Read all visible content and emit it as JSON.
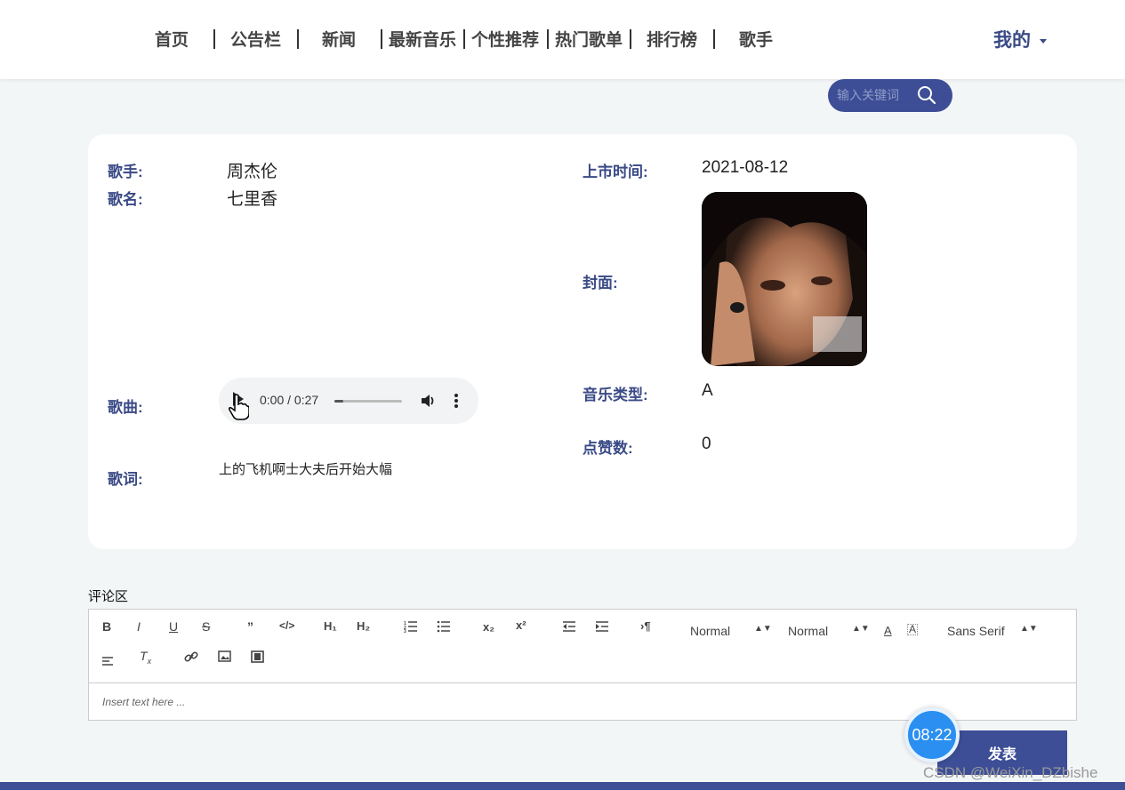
{
  "nav": {
    "items": [
      "首页",
      "公告栏",
      "新闻",
      "最新音乐",
      "个性推荐",
      "热门歌单",
      "排行榜",
      "歌手"
    ],
    "mine": "我的"
  },
  "search": {
    "placeholder": "输入关键词"
  },
  "song": {
    "singer_label": "歌手:",
    "singer": "周杰伦",
    "name_label": "歌名:",
    "name": "七里香",
    "release_label": "上市时间:",
    "release": "2021-08-12",
    "cover_label": "封面:",
    "audio_label": "歌曲:",
    "audio_time": "0:00 / 0:27",
    "audio_progress": 0.0,
    "type_label": "音乐类型:",
    "type": "A",
    "likes_label": "点赞数:",
    "likes": "0",
    "lyrics_label": "歌词:",
    "lyrics": "上的飞机啊士大夫后开始大幅"
  },
  "comments": {
    "title": "评论区",
    "toolbar": {
      "size1": "Normal",
      "size2": "Normal",
      "font": "Sans Serif"
    },
    "placeholder": "Insert text here ...",
    "publish": "发表"
  },
  "timer": "08:22",
  "watermark": "CSDN @WeiXin_DZbishe",
  "colors": {
    "brand": "#3d4e96",
    "label": "#3a4a86",
    "background": "#f3f6f7"
  }
}
